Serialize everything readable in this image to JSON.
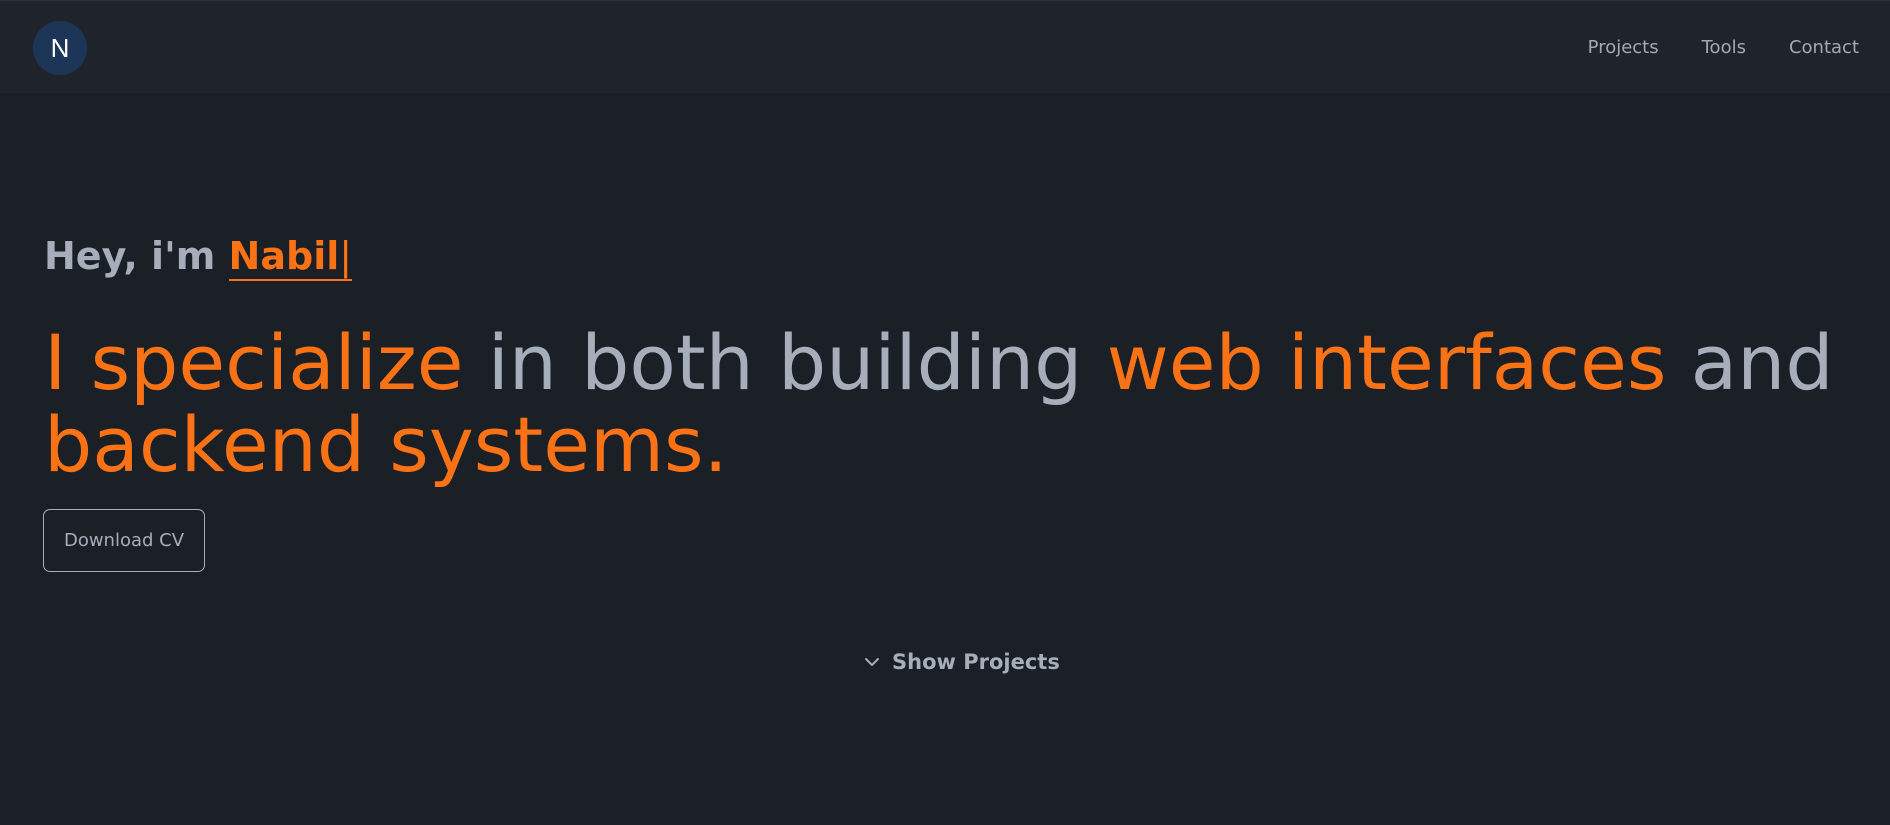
{
  "header": {
    "logo_letter": "N",
    "nav": [
      {
        "label": "Projects"
      },
      {
        "label": "Tools"
      },
      {
        "label": "Contact"
      }
    ]
  },
  "hero": {
    "greeting_prefix": "Hey, i'm ",
    "name": "Nabil",
    "caret": "|",
    "headline": {
      "part1": "I specialize",
      "part2": " in both building ",
      "part3": "web interfaces",
      "part4": " and ",
      "part5": "backend systems."
    },
    "cv_button_label": "Download CV",
    "show_projects_label": "Show Projects"
  },
  "colors": {
    "background": "#1b1f26",
    "navbar": "#1f242c",
    "accent": "#f97316",
    "text_muted": "#a6adbb",
    "logo_bg": "#1d3557"
  },
  "icons": {
    "show_projects": "chevron-down-icon"
  }
}
